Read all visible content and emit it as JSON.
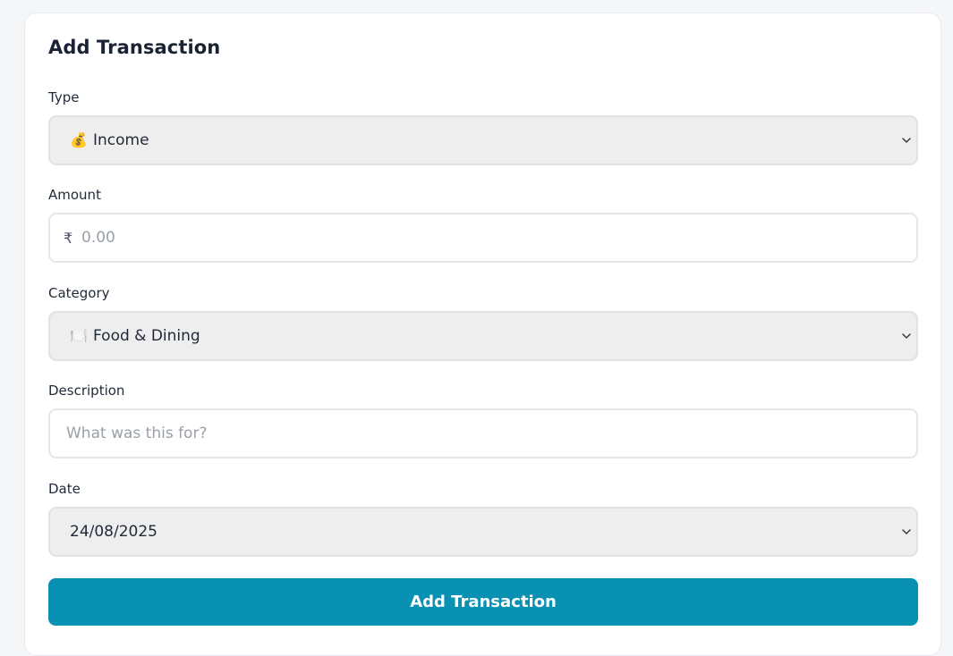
{
  "form": {
    "title": "Add Transaction",
    "type": {
      "label": "Type",
      "emoji": "💰",
      "value": "Income"
    },
    "amount": {
      "label": "Amount",
      "currency_symbol": "₹",
      "placeholder": "0.00"
    },
    "category": {
      "label": "Category",
      "emoji": "🍽️",
      "value": "Food & Dining"
    },
    "description": {
      "label": "Description",
      "placeholder": "What was this for?"
    },
    "date": {
      "label": "Date",
      "value": "24/08/2025"
    },
    "submit_label": "Add Transaction"
  },
  "colors": {
    "accent": "#0891b2",
    "select_bg": "#eeeeee",
    "page_bg": "#f4f6f8"
  },
  "icons": {
    "select_caret": "chevron-down-icon"
  }
}
